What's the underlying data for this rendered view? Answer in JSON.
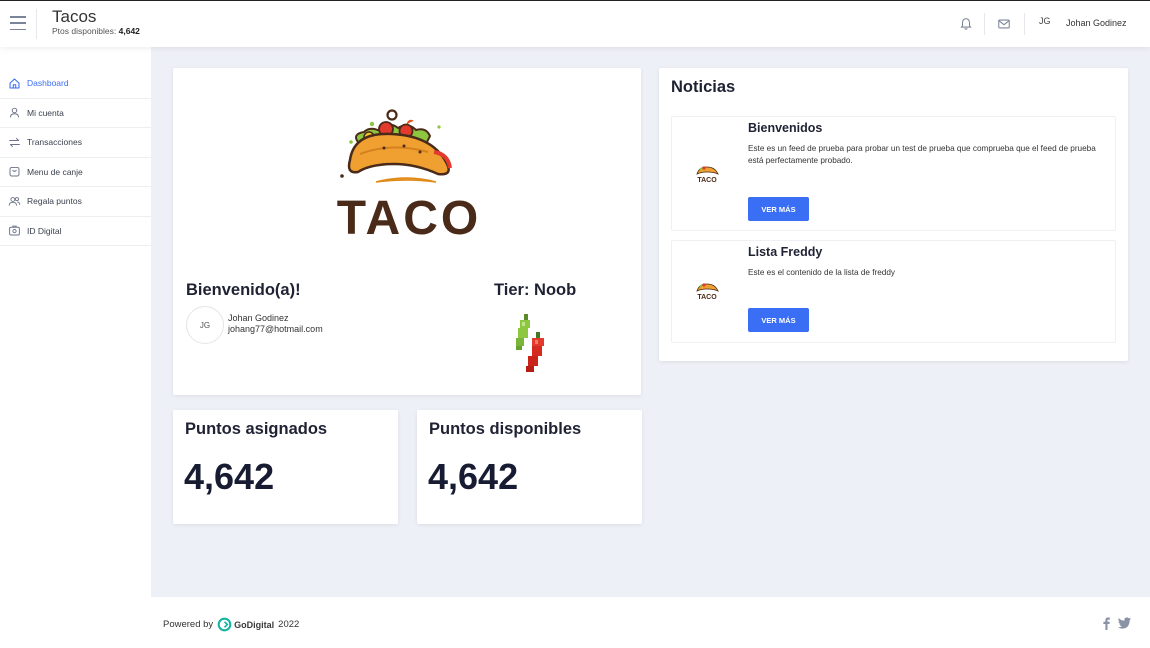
{
  "header": {
    "app_title": "Tacos",
    "points_label": "Ptos disponibles:",
    "points_value": "4,642",
    "avatar_initials": "JG",
    "user_name": "Johan Godinez"
  },
  "sidebar": {
    "items": [
      {
        "label": "Dashboard",
        "icon": "home-icon",
        "active": true
      },
      {
        "label": "Mi cuenta",
        "icon": "user-icon"
      },
      {
        "label": "Transacciones",
        "icon": "transfer-icon"
      },
      {
        "label": "Menu de canje",
        "icon": "basket-icon"
      },
      {
        "label": "Regala puntos",
        "icon": "users-icon"
      },
      {
        "label": "ID Digital",
        "icon": "id-card-icon"
      }
    ]
  },
  "welcome": {
    "logo_text": "TACO",
    "title": "Bienvenido(a)!",
    "avatar_initials": "JG",
    "name": "Johan Godinez",
    "email": "johang77@hotmail.com",
    "tier": "Tier: Noob"
  },
  "stats": [
    {
      "label": "Puntos asignados",
      "value": "4,642"
    },
    {
      "label": "Puntos disponibles",
      "value": "4,642"
    }
  ],
  "news": {
    "title": "Noticias",
    "items": [
      {
        "title": "Bienvenidos",
        "body": "Este es un feed de prueba para probar un test de prueba que comprueba que el feed de prueba está perfectamente probado.",
        "button": "VER MÁS",
        "thumb_text": "TACO"
      },
      {
        "title": "Lista Freddy",
        "body": "Este es el contenido de la lista de freddy",
        "button": "VER MÁS",
        "thumb_text": "TACO"
      }
    ]
  },
  "footer": {
    "powered_by": "Powered by",
    "brand": "GoDigital",
    "year": "2022"
  },
  "colors": {
    "accent": "#3a6ef5",
    "background": "#eef0f7",
    "dark_text": "#171c33"
  }
}
